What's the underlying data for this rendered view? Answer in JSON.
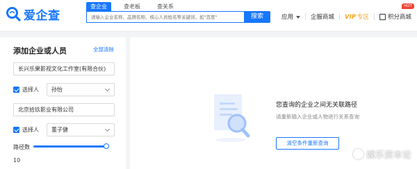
{
  "brand": {
    "name": "爱企查",
    "color": "#1677ff"
  },
  "search": {
    "tabs": [
      "查企业",
      "查老板",
      "查关系"
    ],
    "active_tab": 0,
    "placeholder": "请输入企业名称、品牌名称、核心人员姓名等关键词，如\"百度\"",
    "button_label": "搜索"
  },
  "topnav": {
    "apps_label": "应用",
    "mall_label": "企服商城",
    "vip_label": "VIP",
    "vip_sub": "专区",
    "points_label": "积分商城",
    "hot_badge": "HOT"
  },
  "panel": {
    "title": "添加企业或人员",
    "clear_label": "全部清除",
    "entries": [
      {
        "company": "长兴乐果影视文化工作室(有限合伙)",
        "checkbox_label": "选择人",
        "person": "孙怡"
      },
      {
        "company": "北京拾玖影业有限公司",
        "checkbox_label": "选择人",
        "person": "董子健"
      }
    ],
    "depth_label": "路径数",
    "depth_value": "10",
    "depth_fraction": 1.0
  },
  "empty_state": {
    "title": "您查询的企业之间无关联路径",
    "subtitle": "请重新输入企业或人物进行关系查询",
    "button_label": "清空条件重新查询"
  },
  "watermark": "娱乐资本论",
  "colors": {
    "accent": "#1677ff",
    "vip": "#f5a623",
    "hot": "#f04134"
  }
}
